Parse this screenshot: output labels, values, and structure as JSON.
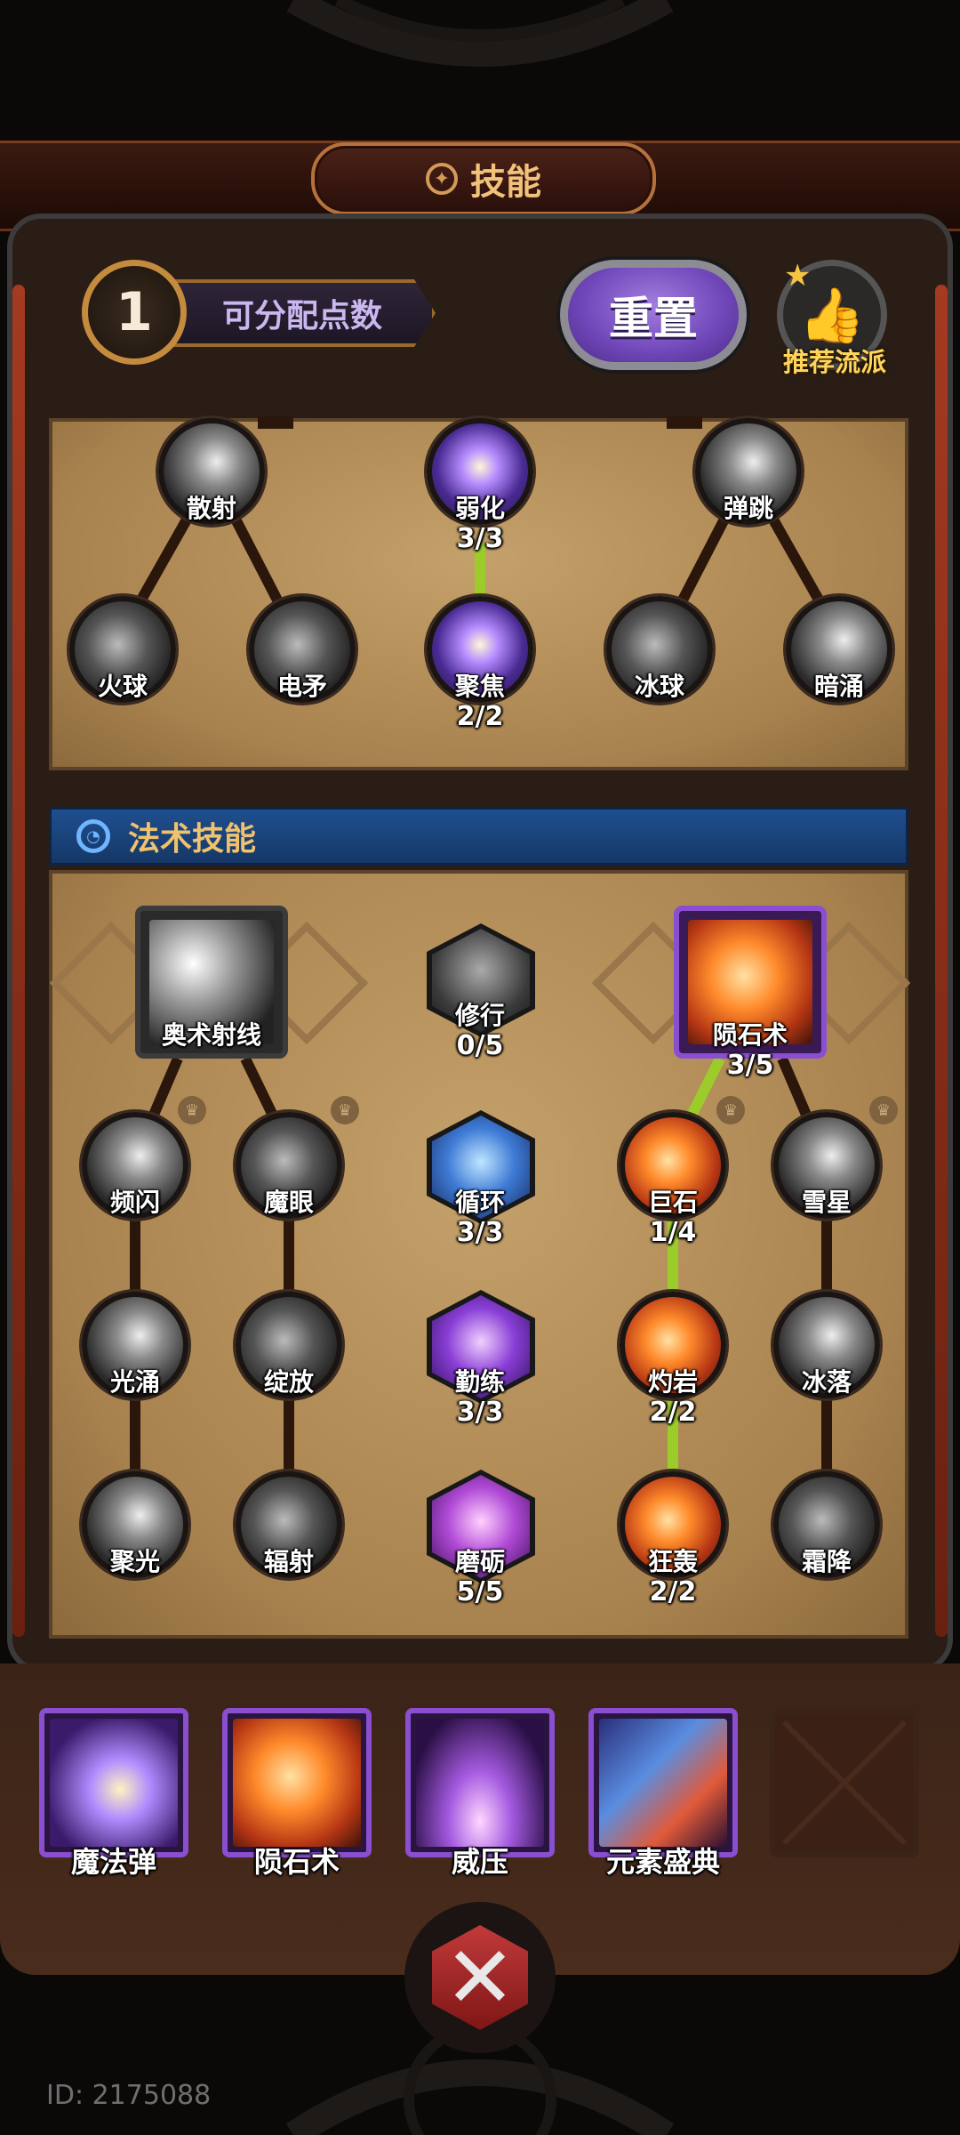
{
  "header": {
    "title": "技能",
    "title_icon": "pentagram-icon"
  },
  "points": {
    "value": "1",
    "label": "可分配点数"
  },
  "reset_button": {
    "label": "重置"
  },
  "recommend_button": {
    "label": "推荐流派",
    "icon": "thumbs-up-icon"
  },
  "top_tree": {
    "row1": [
      {
        "name": "散射",
        "level": ""
      },
      {
        "name": "弱化",
        "level": "3/3"
      },
      {
        "name": "弹跳",
        "level": ""
      }
    ],
    "row2": [
      {
        "name": "火球",
        "level": ""
      },
      {
        "name": "电矛",
        "level": ""
      },
      {
        "name": "聚焦",
        "level": "2/2"
      },
      {
        "name": "冰球",
        "level": ""
      },
      {
        "name": "暗涌",
        "level": ""
      }
    ]
  },
  "spell_section": {
    "title": "法术技能",
    "icon": "swirl-icon"
  },
  "spell_tree": {
    "roots": {
      "left": {
        "name": "奥术射线",
        "level": ""
      },
      "center": {
        "name": "修行",
        "level": "0/5"
      },
      "right": {
        "name": "陨石术",
        "level": "3/5"
      }
    },
    "row1": [
      {
        "name": "频闪",
        "level": ""
      },
      {
        "name": "魔眼",
        "level": ""
      },
      {
        "name": "循环",
        "level": "3/3"
      },
      {
        "name": "巨石",
        "level": "1/4"
      },
      {
        "name": "雪星",
        "level": ""
      }
    ],
    "row2": [
      {
        "name": "光涌",
        "level": ""
      },
      {
        "name": "绽放",
        "level": ""
      },
      {
        "name": "勤练",
        "level": "3/3"
      },
      {
        "name": "灼岩",
        "level": "2/2"
      },
      {
        "name": "冰落",
        "level": ""
      }
    ],
    "row3": [
      {
        "name": "聚光",
        "level": ""
      },
      {
        "name": "辐射",
        "level": ""
      },
      {
        "name": "磨砺",
        "level": "5/5"
      },
      {
        "name": "狂轰",
        "level": "2/2"
      },
      {
        "name": "霜降",
        "level": ""
      }
    ]
  },
  "equipped": [
    {
      "name": "魔法弹"
    },
    {
      "name": "陨石术"
    },
    {
      "name": "威压"
    },
    {
      "name": "元素盛典"
    }
  ],
  "close_button": {
    "icon": "crossed-swords-close-icon"
  },
  "footer": {
    "id_text": "ID: 2175088"
  },
  "colors": {
    "accent_purple": "#8a4fd0",
    "connector_green": "#9ccc2a",
    "panel_tan": "#b08a55",
    "section_blue": "#1f4f90"
  }
}
